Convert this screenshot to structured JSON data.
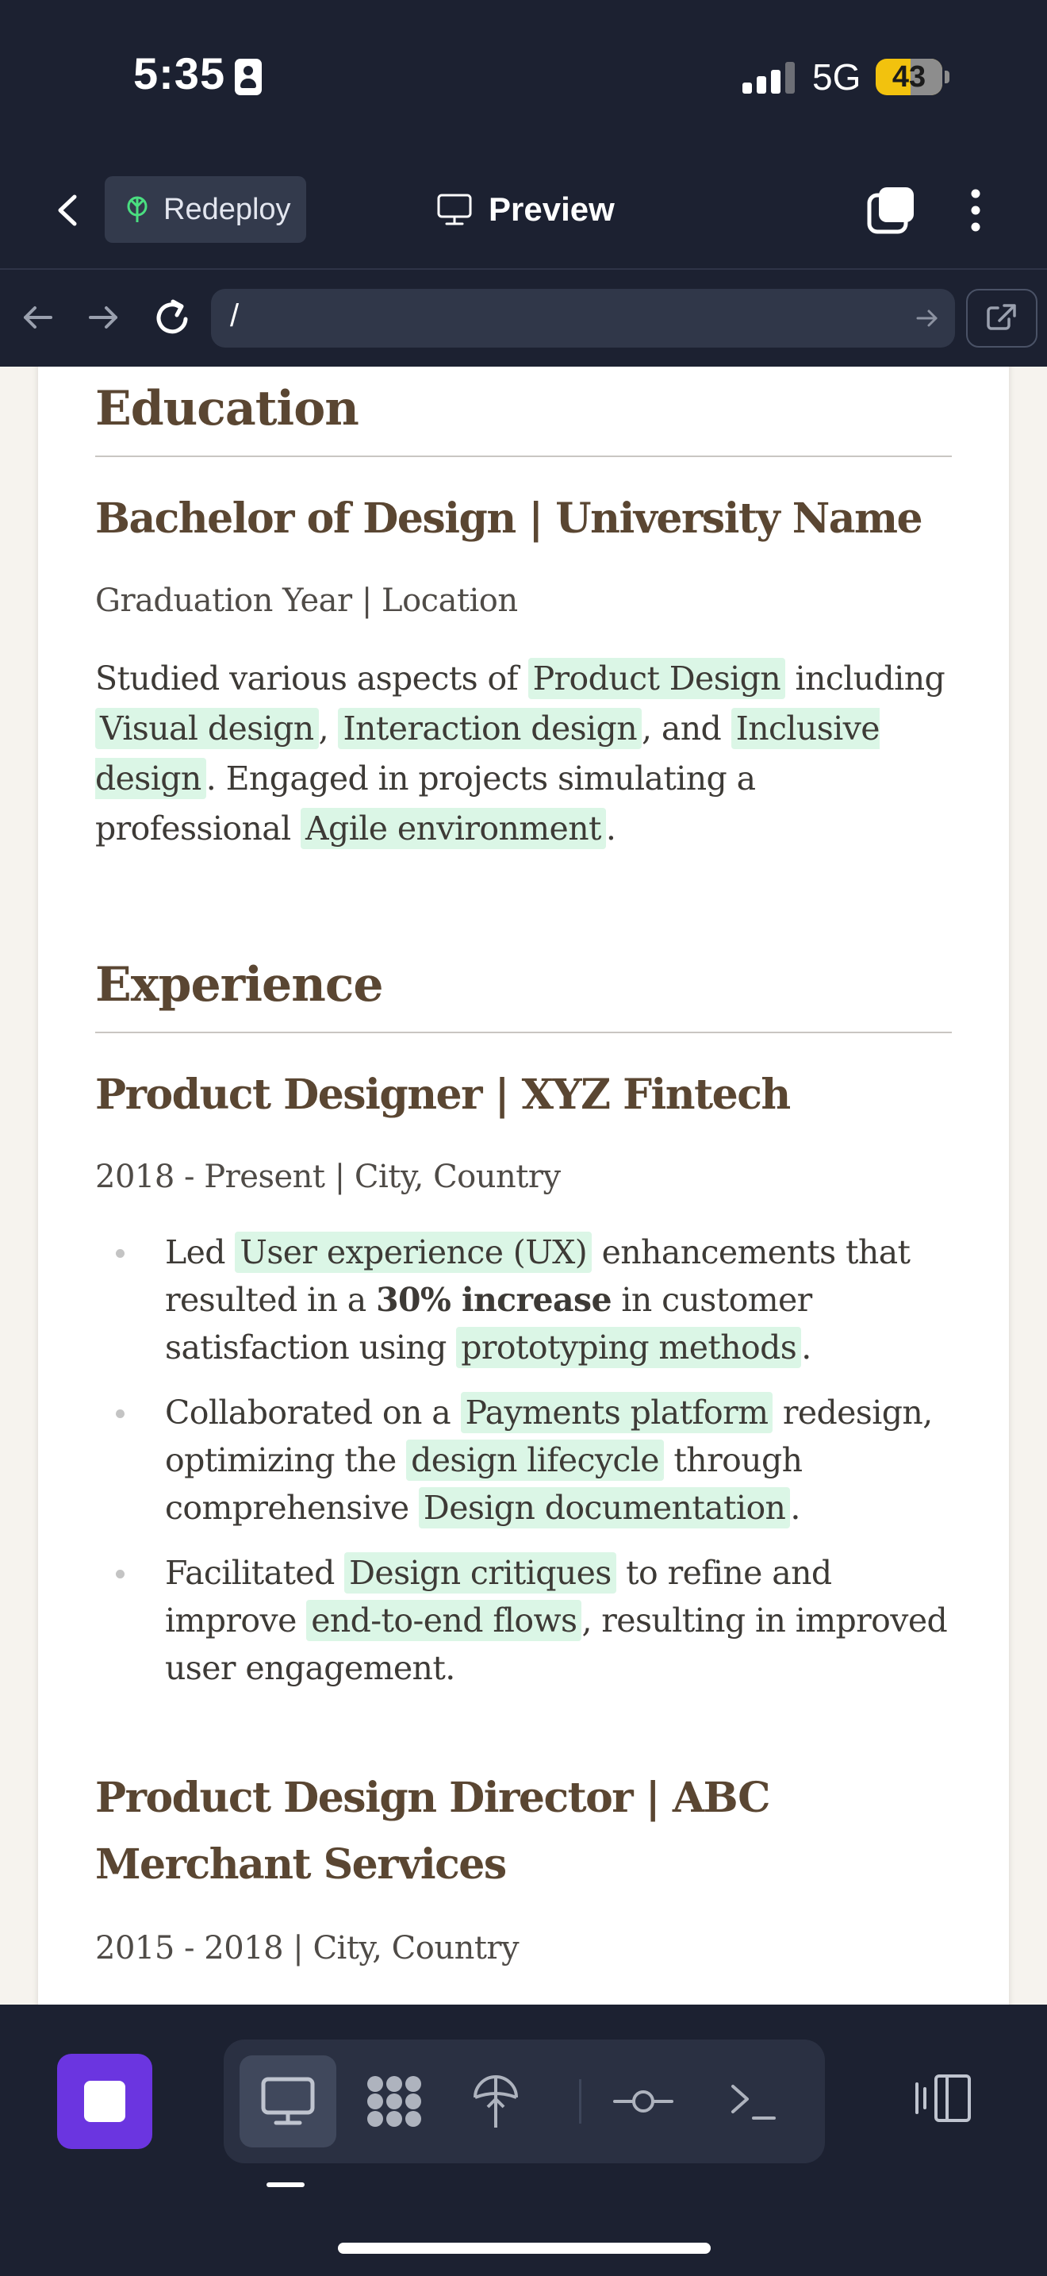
{
  "status_bar": {
    "time": "5:35",
    "network": "5G",
    "battery": "43",
    "battery_level": 0.43
  },
  "header": {
    "redeploy_label": "Redeploy",
    "title": "Preview"
  },
  "url_bar": {
    "url": "/"
  },
  "resume": {
    "education": {
      "heading": "Education",
      "degree": "Bachelor of Design | University Name",
      "meta": "Graduation Year | Location",
      "p1_a": "Studied various aspects of ",
      "p1_hl1": "Product Design",
      "p1_b": " including ",
      "p1_hl2": "Visual design",
      "p1_c": ", ",
      "p1_hl3": "Interaction design",
      "p1_d": ", and ",
      "p1_hl4": "Inclusive design",
      "p1_e": ". Engaged in projects simulating a professional ",
      "p1_hl5": "Agile environment",
      "p1_f": "."
    },
    "experience": {
      "heading": "Experience",
      "job1": {
        "title": "Product Designer | XYZ Fintech",
        "meta": "2018 - Present | City, Country",
        "b1_a": "Led ",
        "b1_hl1": "User experience (UX)",
        "b1_b": " enhancements that resulted in a ",
        "b1_strong": "30% increase",
        "b1_c": " in customer satisfaction using ",
        "b1_hl2": "prototyping methods",
        "b1_d": ".",
        "b2_a": "Collaborated on a ",
        "b2_hl1": "Payments platform",
        "b2_b": " redesign, optimizing the ",
        "b2_hl2": "design lifecycle",
        "b2_c": " through comprehensive ",
        "b2_hl3": "Design documentation",
        "b2_d": ".",
        "b3_a": "Facilitated ",
        "b3_hl1": "Design critiques",
        "b3_b": " to refine and improve ",
        "b3_hl2": "end-to-end flows",
        "b3_c": ", resulting in improved user engagement."
      },
      "job2": {
        "title": "Product Design Director | ABC Merchant Services",
        "meta": "2015 - 2018 | City, Country"
      }
    }
  },
  "toolbar": {
    "tools": [
      "monitor-icon",
      "packages-icon",
      "deploy-icon",
      "git-commit-icon",
      "terminal-icon"
    ],
    "active_tool": "monitor-icon"
  },
  "colors": {
    "accent": "#6b35e0",
    "highlight": "#dbf6e6",
    "heading": "#5a4632",
    "chrome": "#1c2131"
  }
}
